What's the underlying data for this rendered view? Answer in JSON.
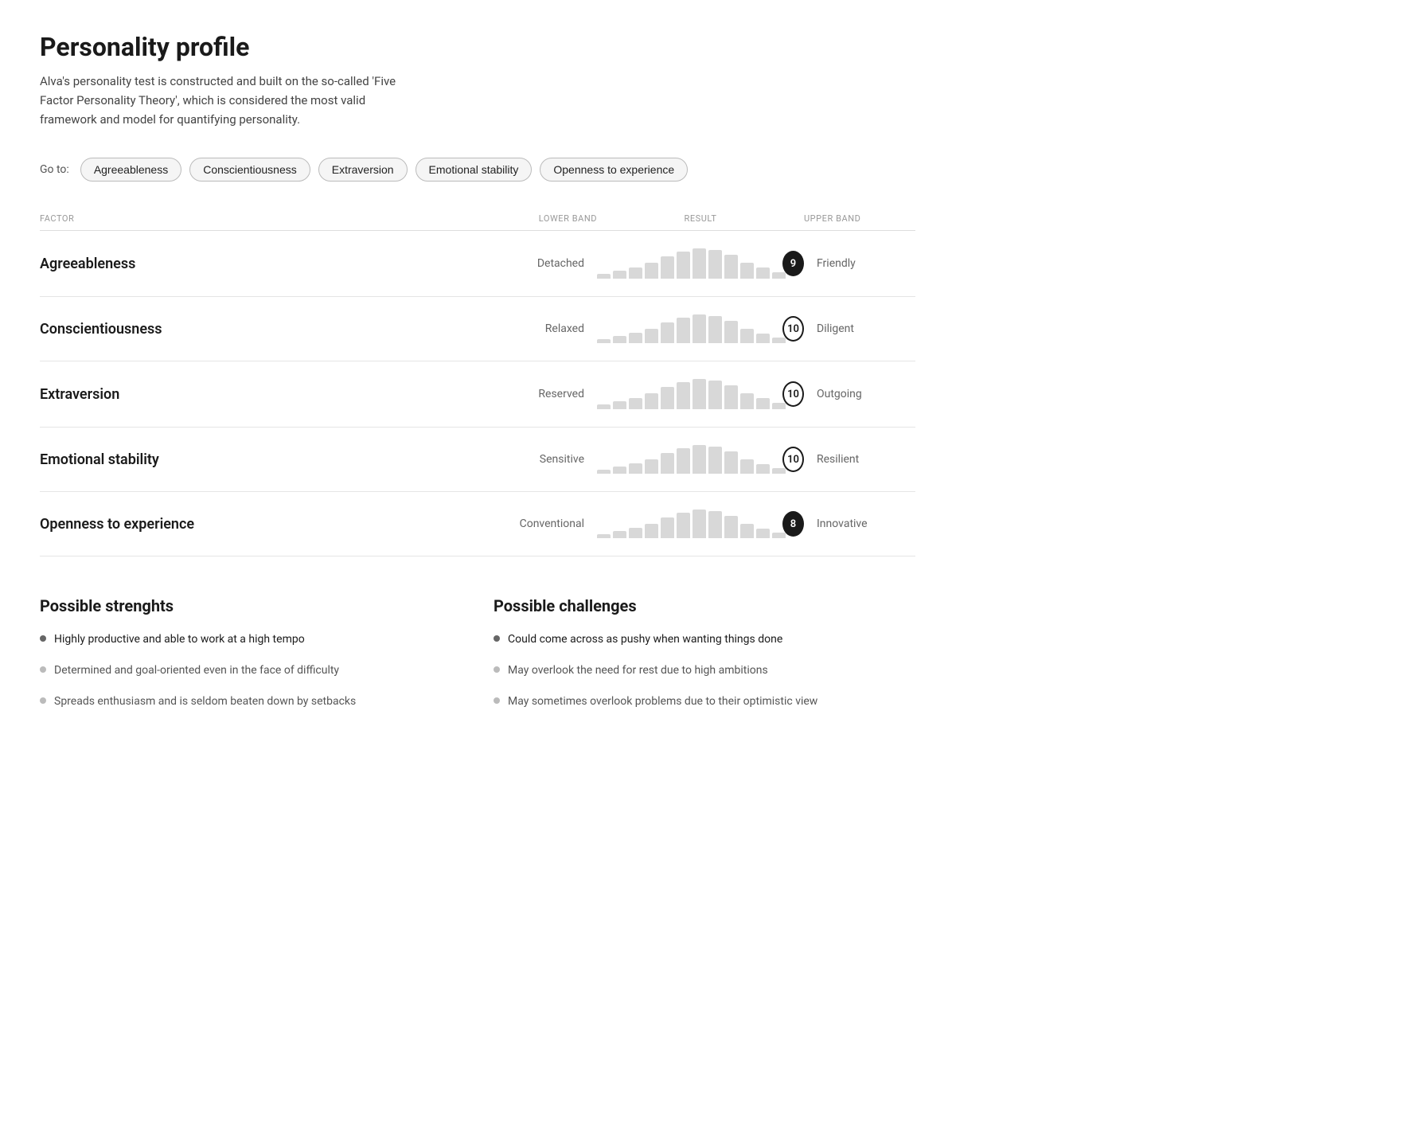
{
  "page": {
    "title": "Personality profile",
    "subtitle": "Alva's personality test is constructed and built on the so-called 'Five Factor Personality Theory', which is considered the most valid framework and model for quantifying personality."
  },
  "goto": {
    "label": "Go to:",
    "buttons": [
      "Agreeableness",
      "Conscientiousness",
      "Extraversion",
      "Emotional stability",
      "Openness to experience"
    ]
  },
  "table": {
    "headers": [
      "FACTOR",
      "LOWER BAND",
      "RESULT",
      "UPPER BAND"
    ],
    "rows": [
      {
        "factor": "Agreeableness",
        "lower": "Detached",
        "score": 9,
        "scoreDark": true,
        "upper": "Friendly",
        "bars": [
          6,
          10,
          14,
          20,
          28,
          34,
          38,
          36,
          30,
          20,
          14,
          8
        ]
      },
      {
        "factor": "Conscientiousness",
        "lower": "Relaxed",
        "score": 10,
        "scoreDark": false,
        "upper": "Diligent",
        "bars": [
          5,
          9,
          13,
          18,
          26,
          32,
          36,
          34,
          28,
          18,
          12,
          7
        ]
      },
      {
        "factor": "Extraversion",
        "lower": "Reserved",
        "score": 10,
        "scoreDark": false,
        "upper": "Outgoing",
        "bars": [
          6,
          10,
          14,
          20,
          28,
          34,
          38,
          36,
          30,
          20,
          14,
          8
        ]
      },
      {
        "factor": "Emotional stability",
        "lower": "Sensitive",
        "score": 10,
        "scoreDark": false,
        "upper": "Resilient",
        "bars": [
          5,
          9,
          13,
          18,
          26,
          32,
          36,
          34,
          28,
          18,
          12,
          7
        ]
      },
      {
        "factor": "Openness to experience",
        "lower": "Conventional",
        "score": 8,
        "scoreDark": true,
        "upper": "Innovative",
        "bars": [
          5,
          9,
          13,
          18,
          26,
          32,
          36,
          34,
          28,
          18,
          12,
          7
        ]
      }
    ]
  },
  "strengths": {
    "title": "Possible strenghts",
    "items": [
      {
        "text": "Highly productive and able to work at a high tempo",
        "active": true
      },
      {
        "text": "Determined and goal-oriented even in the face of difficulty",
        "active": false
      },
      {
        "text": "Spreads enthusiasm and is seldom beaten down by setbacks",
        "active": false
      }
    ]
  },
  "challenges": {
    "title": "Possible challenges",
    "items": [
      {
        "text": "Could come across as pushy when wanting things done",
        "active": true
      },
      {
        "text": "May overlook the need for rest due to high ambitions",
        "active": false
      },
      {
        "text": "May sometimes overlook problems due to their optimistic view",
        "active": false
      }
    ]
  }
}
